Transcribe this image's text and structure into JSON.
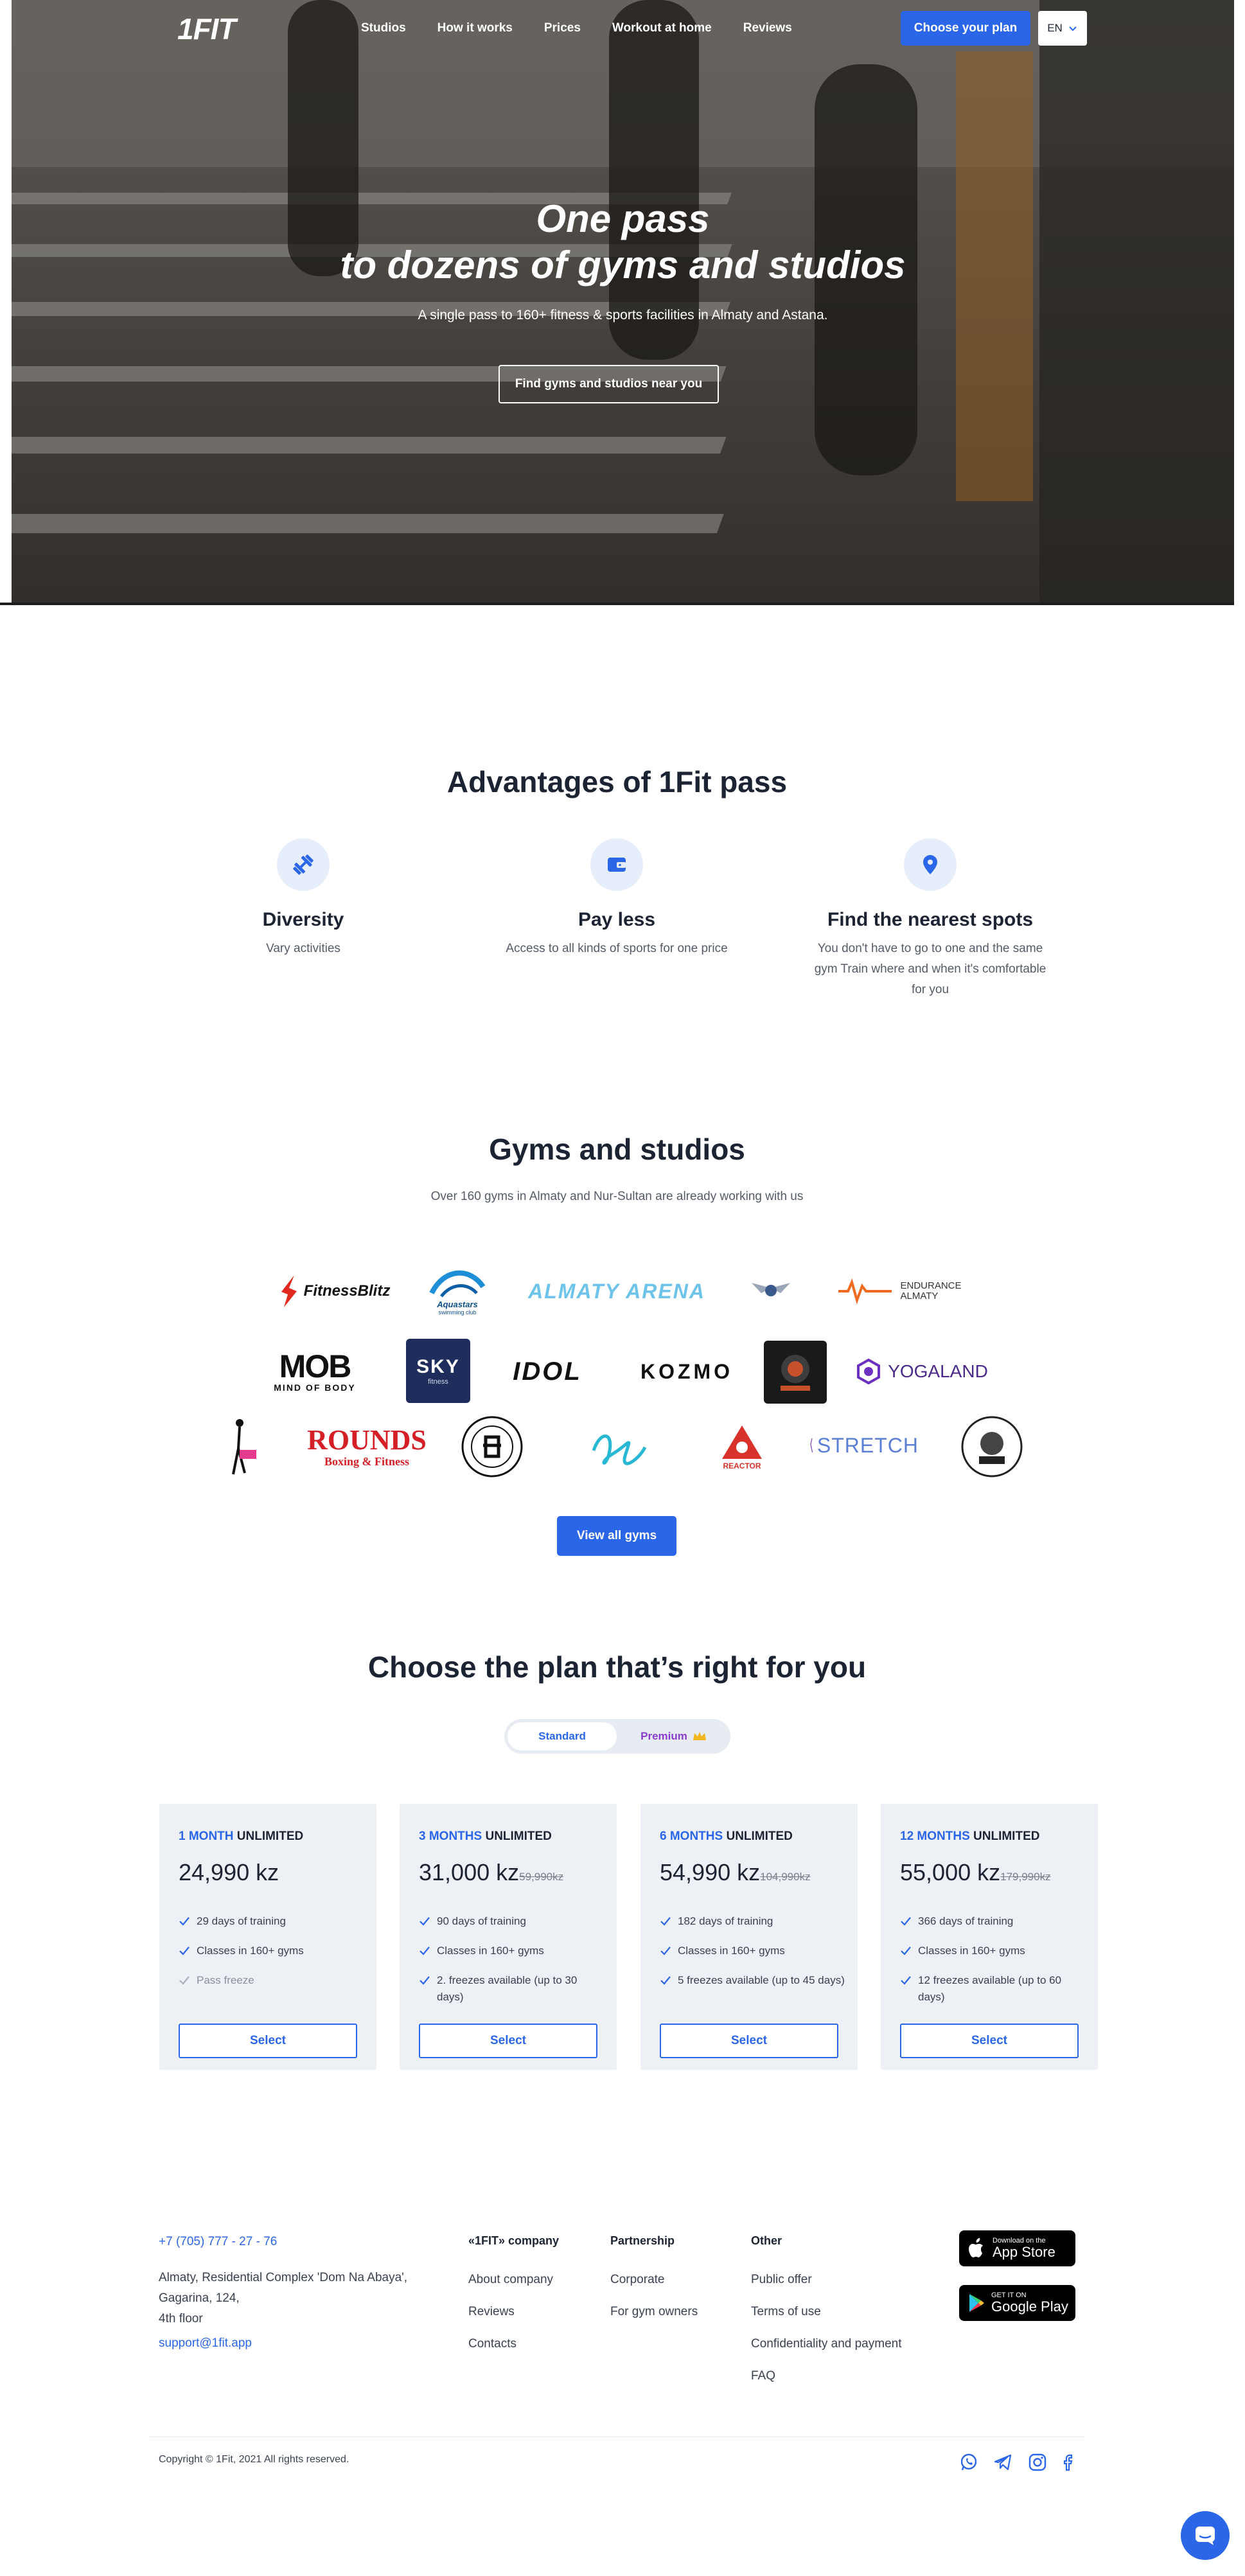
{
  "nav": {
    "logo": "1FIT",
    "links": [
      "Studios",
      "How it works",
      "Prices",
      "Workout at home",
      "Reviews"
    ],
    "cta": "Choose your plan",
    "language": "EN"
  },
  "hero": {
    "title_line1": "One pass",
    "title_line2": "to dozens of gyms and studios",
    "subtitle": "A single pass to 160+ fitness & sports facilities in Almaty and Astana.",
    "button": "Find gyms and studios near you"
  },
  "advantages": {
    "title": "Advantages of 1Fit pass",
    "items": [
      {
        "title": "Diversity",
        "text": "Vary activities",
        "icon": "dumbbell-icon"
      },
      {
        "title": "Pay less",
        "text": "Access to all kinds of sports for one price",
        "icon": "wallet-icon"
      },
      {
        "title": "Find the nearest spots",
        "text": "You don't have to go to one and the same gym Train where and when it's comfortable for you",
        "icon": "location-pin-icon"
      }
    ]
  },
  "gyms": {
    "title": "Gyms and studios",
    "subtitle": "Over 160 gyms in Almaty and Nur-Sultan are already working with us",
    "button": "View all gyms",
    "logos": {
      "fitnessblitz": "FitnessBlitz",
      "aquastars": "Aquastars",
      "aquastars_sub": "swimming club",
      "almaty_arena": "ALMATY ARENA",
      "endurance": "ENDURANCE",
      "endurance_sub": "ALMATY",
      "mob": "MOB",
      "mob_sub": "MIND OF BODY",
      "sky": "SKY",
      "sky_sub": "fitness",
      "idol": "IDOL",
      "kozmo": "KOZMO",
      "yogaland": "YOGALAND",
      "rounds": "ROUNDS",
      "rounds_sub": "Boxing & Fitness",
      "reactor": "REACTOR",
      "stretch": "STRETCH"
    }
  },
  "plans": {
    "title": "Choose the plan that’s right for you",
    "toggle_standard": "Standard",
    "toggle_premium": "Premium",
    "select_label": "Select",
    "items": [
      {
        "months": "1 MONTH",
        "unlimited": "UNLIMITED",
        "price": "24,990 kz",
        "old": "",
        "f1": "29 days of training",
        "f2": "Classes in 160+ gyms",
        "f3": "Pass freeze"
      },
      {
        "months": "3 MONTHS",
        "unlimited": "UNLIMITED",
        "price": "31,000 kz",
        "old": "59,990kz",
        "f1": "90 days of training",
        "f2": "Classes in 160+ gyms",
        "f3": "2. freezes available (up to 30 days)"
      },
      {
        "months": "6 MONTHS",
        "unlimited": "UNLIMITED",
        "price": "54,990 kz",
        "old": "104,990kz",
        "f1": "182 days of training",
        "f2": "Classes in 160+ gyms",
        "f3": "5 freezes available (up to 45 days)"
      },
      {
        "months": "12 MONTHS",
        "unlimited": "UNLIMITED",
        "price": "55,000 kz",
        "old": "179,990kz",
        "f1": "366 days of training",
        "f2": "Classes in 160+ gyms",
        "f3": "12 freezes available (up to 60 days)"
      }
    ]
  },
  "footer": {
    "phone": "+7 (705) 777 - 27 - 76",
    "address1": "Almaty, Residential Complex 'Dom Na Abaya',",
    "address2": "Gagarina, 124,",
    "address3": "4th floor",
    "email": "support@1fit.app",
    "company_head": "«1FIT» company",
    "company_links": [
      "About company",
      "Reviews",
      "Contacts"
    ],
    "partnership_head": "Partnership",
    "partnership_links": [
      "Corporate",
      "For gym owners"
    ],
    "other_head": "Other",
    "other_links": [
      "Public offer",
      "Terms of use",
      "Confidentiality and payment",
      "FAQ"
    ],
    "appstore_small": "Download on the",
    "appstore_big": "App Store",
    "googleplay_small": "GET IT ON",
    "googleplay_big": "Google Play",
    "copyright": "Copyright © 1Fit, 2021 All rights reserved."
  },
  "colors": {
    "accent": "#2b66e8",
    "premium": "#8a3ccf",
    "card_bg": "#edf0f5"
  }
}
